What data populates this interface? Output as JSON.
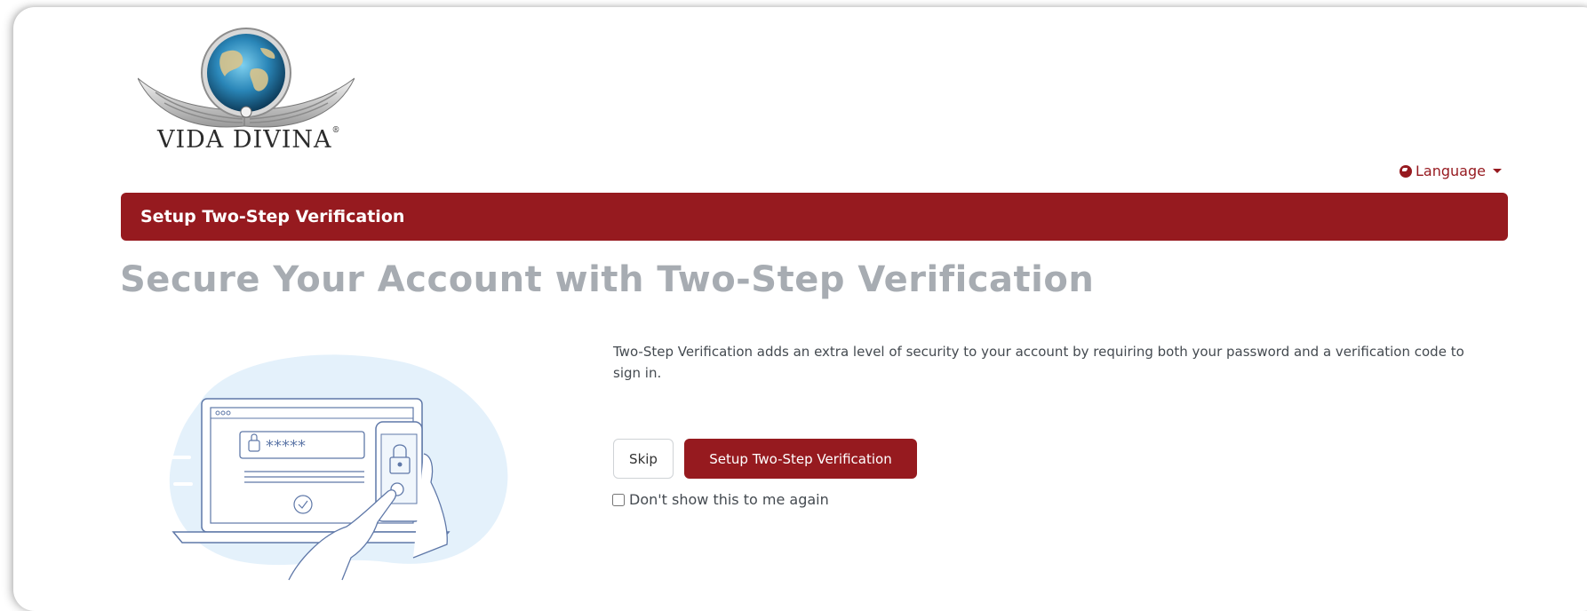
{
  "brand": {
    "logo_text": "VIDA DIVINA",
    "logo_mark": "®"
  },
  "header": {
    "language_label": "Language"
  },
  "banner": {
    "title": "Setup Two-Step Verification"
  },
  "main": {
    "heading": "Secure Your Account with Two-Step Verification",
    "description": "Two-Step Verification adds an extra level of security to your account by requiring both your password and a verification code to sign in.",
    "skip_label": "Skip",
    "setup_label": "Setup Two-Step Verification",
    "dont_show_label": "Don't show this to me again",
    "dont_show_checked": false
  },
  "icons": [
    "globe-icon",
    "chevron-down-icon",
    "two-step-illustration"
  ],
  "colors": {
    "brand_red": "#961a1f",
    "heading_gray": "#a7acb2",
    "text_gray": "#444a50",
    "illustration_blue": "#e3f0fb"
  }
}
